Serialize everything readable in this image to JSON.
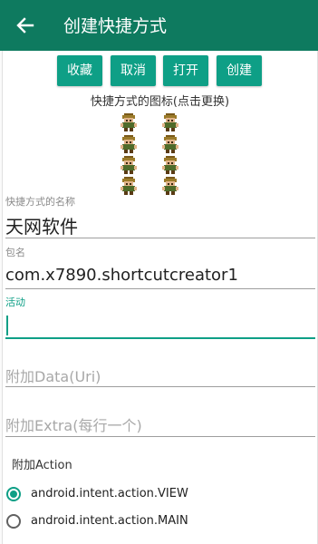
{
  "appbar": {
    "title": "创建快捷方式",
    "back_icon": "arrow-left-icon",
    "background": "#0e7a5f"
  },
  "actions": {
    "favorite_label": "收藏",
    "cancel_label": "取消",
    "open_label": "打开",
    "create_label": "创建",
    "button_color": "#0e9f86"
  },
  "icons_section": {
    "caption": "快捷方式的图标(点击更换)",
    "sprites": [
      "character-sprite-icon",
      "character-sprite-icon",
      "character-sprite-icon",
      "character-sprite-icon",
      "character-sprite-icon",
      "character-sprite-icon",
      "character-sprite-icon",
      "character-sprite-icon"
    ]
  },
  "fields": {
    "name": {
      "label": "快捷方式的名称",
      "value": "天网软件"
    },
    "package": {
      "label": "包名",
      "value": "com.x7890.shortcutcreator1"
    },
    "activity": {
      "label": "活动",
      "value": ""
    },
    "data_uri": {
      "placeholder": "附加Data(Uri)"
    },
    "extra": {
      "placeholder": "附加Extra(每行一个)"
    }
  },
  "action_section": {
    "label": "附加Action",
    "options": [
      {
        "label": "android.intent.action.VIEW",
        "selected": true
      },
      {
        "label": "android.intent.action.MAIN",
        "selected": false
      }
    ]
  },
  "accent_color": "#0e9f86"
}
